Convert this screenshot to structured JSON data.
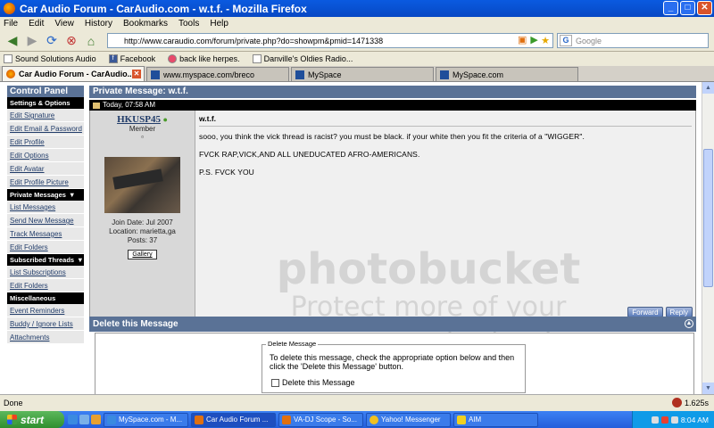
{
  "window": {
    "title": "Car Audio Forum - CarAudio.com - w.t.f. - Mozilla Firefox"
  },
  "menu": [
    "File",
    "Edit",
    "View",
    "History",
    "Bookmarks",
    "Tools",
    "Help"
  ],
  "nav": {
    "url": "http://www.caraudio.com/forum/private.php?do=showpm&pmid=1471338",
    "search_placeholder": "Google"
  },
  "bookmarks": [
    "Sound Solutions Audio",
    "Facebook",
    "back like herpes.",
    "Danville's Oldies Radio..."
  ],
  "tabs": [
    "Car Audio Forum - CarAudio...",
    "www.myspace.com/breco",
    "MySpace",
    "MySpace.com"
  ],
  "sidebar": {
    "title": "Control Panel",
    "sections": [
      {
        "heading": "Settings & Options",
        "items": [
          "Edit Signature",
          "Edit Email & Password",
          "Edit Profile",
          "Edit Options",
          "Edit Avatar",
          "Edit Profile Picture"
        ]
      },
      {
        "heading": "Private Messages",
        "items": [
          "List Messages",
          "Send New Message",
          "Track Messages",
          "Edit Folders"
        ]
      },
      {
        "heading": "Subscribed Threads",
        "items": [
          "List Subscriptions",
          "Edit Folders"
        ]
      },
      {
        "heading": "Miscellaneous",
        "items": [
          "Event Reminders",
          "Buddy / Ignore Lists",
          "Attachments"
        ]
      }
    ]
  },
  "pm": {
    "title": "Private Message: w.t.f.",
    "date": "Today, 07:58 AM",
    "user": {
      "name": "HKUSP45",
      "title": "Member",
      "join": "Join Date: Jul 2007",
      "location": "Location: marietta,ga",
      "posts": "Posts: 37",
      "gallery": "Gallery"
    },
    "subject": "w.t.f.",
    "lines": [
      "sooo, you think the vick thread is racist? you must be black. if your white then you fit the criteria of a \"WIGGER\".",
      "FVCK RAP,VICK,AND ALL UNEDUCATED AFRO-AMERICANS.",
      "P.S. FVCK YOU"
    ],
    "forward_label": "Forward",
    "reply_label": "Reply"
  },
  "delete": {
    "header": "Delete this Message",
    "legend": "Delete Message",
    "text": "To delete this message, check the appropriate option below and then click the 'Delete this Message' button.",
    "checkbox_label": "Delete this Message"
  },
  "watermark": {
    "line1": "photobucket",
    "line2": "Protect more of your memories for less!"
  },
  "status": {
    "text": "Done",
    "time": "1.625s"
  },
  "taskbar": {
    "start": "start",
    "tasks": [
      "MySpace.com - M...",
      "Car Audio Forum ...",
      "VA-DJ Scope - So...",
      "Yahoo! Messenger",
      "AIM"
    ],
    "clock": "8:04 AM"
  }
}
